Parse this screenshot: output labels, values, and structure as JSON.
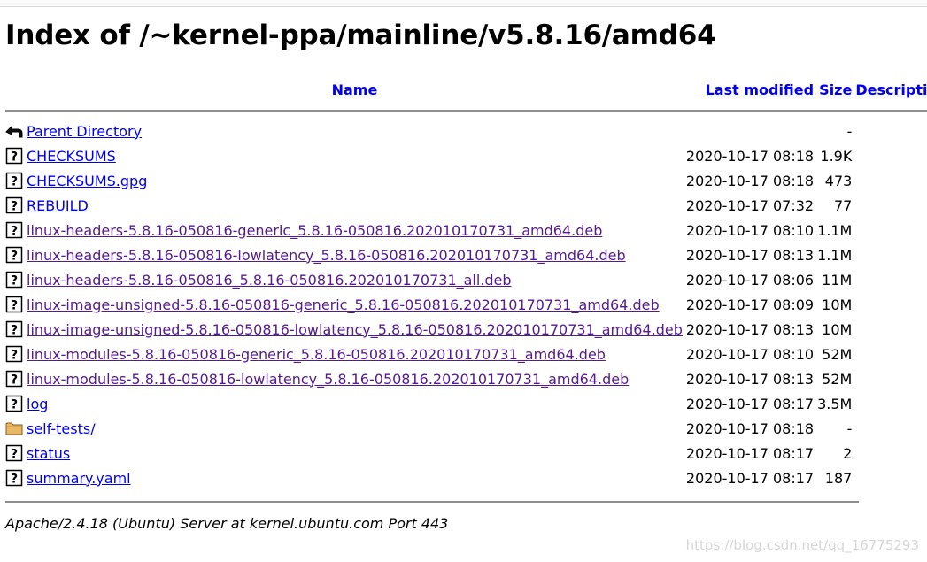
{
  "page": {
    "title": "Index of /~kernel-ppa/mainline/v5.8.16/amd64"
  },
  "table": {
    "headers": {
      "name": "Name",
      "last_modified": "Last modified",
      "size": "Size",
      "description": "Description"
    },
    "parent": {
      "name": "Parent Directory",
      "size": "-",
      "icon": "back-icon"
    },
    "rows": [
      {
        "name": "CHECKSUMS",
        "date": "2020-10-17 08:18",
        "size": "1.9K",
        "icon": "unknown-file-icon",
        "visited": false
      },
      {
        "name": "CHECKSUMS.gpg",
        "date": "2020-10-17 08:18",
        "size": "473",
        "icon": "unknown-file-icon",
        "visited": false
      },
      {
        "name": "REBUILD",
        "date": "2020-10-17 07:32",
        "size": "77",
        "icon": "unknown-file-icon",
        "visited": false
      },
      {
        "name": "linux-headers-5.8.16-050816-generic_5.8.16-050816.202010170731_amd64.deb",
        "date": "2020-10-17 08:10",
        "size": "1.1M",
        "icon": "unknown-file-icon",
        "visited": true
      },
      {
        "name": "linux-headers-5.8.16-050816-lowlatency_5.8.16-050816.202010170731_amd64.deb",
        "date": "2020-10-17 08:13",
        "size": "1.1M",
        "icon": "unknown-file-icon",
        "visited": true
      },
      {
        "name": "linux-headers-5.8.16-050816_5.8.16-050816.202010170731_all.deb",
        "date": "2020-10-17 08:06",
        "size": "11M",
        "icon": "unknown-file-icon",
        "visited": true
      },
      {
        "name": "linux-image-unsigned-5.8.16-050816-generic_5.8.16-050816.202010170731_amd64.deb",
        "date": "2020-10-17 08:09",
        "size": "10M",
        "icon": "unknown-file-icon",
        "visited": true
      },
      {
        "name": "linux-image-unsigned-5.8.16-050816-lowlatency_5.8.16-050816.202010170731_amd64.deb",
        "date": "2020-10-17 08:13",
        "size": "10M",
        "icon": "unknown-file-icon",
        "visited": true
      },
      {
        "name": "linux-modules-5.8.16-050816-generic_5.8.16-050816.202010170731_amd64.deb",
        "date": "2020-10-17 08:10",
        "size": "52M",
        "icon": "unknown-file-icon",
        "visited": true
      },
      {
        "name": "linux-modules-5.8.16-050816-lowlatency_5.8.16-050816.202010170731_amd64.deb",
        "date": "2020-10-17 08:13",
        "size": "52M",
        "icon": "unknown-file-icon",
        "visited": true
      },
      {
        "name": "log",
        "date": "2020-10-17 08:17",
        "size": "3.5M",
        "icon": "unknown-file-icon",
        "visited": false
      },
      {
        "name": "self-tests/",
        "date": "2020-10-17 08:18",
        "size": "-",
        "icon": "folder-icon",
        "visited": false
      },
      {
        "name": "status",
        "date": "2020-10-17 08:17",
        "size": "2",
        "icon": "unknown-file-icon",
        "visited": false
      },
      {
        "name": "summary.yaml",
        "date": "2020-10-17 08:17",
        "size": "187",
        "icon": "unknown-file-icon",
        "visited": false
      }
    ]
  },
  "footer": {
    "server_signature": "Apache/2.4.18 (Ubuntu) Server at kernel.ubuntu.com Port 443"
  },
  "watermark": {
    "text": "https://blog.csdn.net/qq_16775293"
  },
  "colors": {
    "link": "#0000ee",
    "visited_link": "#551a8b",
    "rule": "#8f8f8f",
    "watermark": "#d6d6d6"
  }
}
